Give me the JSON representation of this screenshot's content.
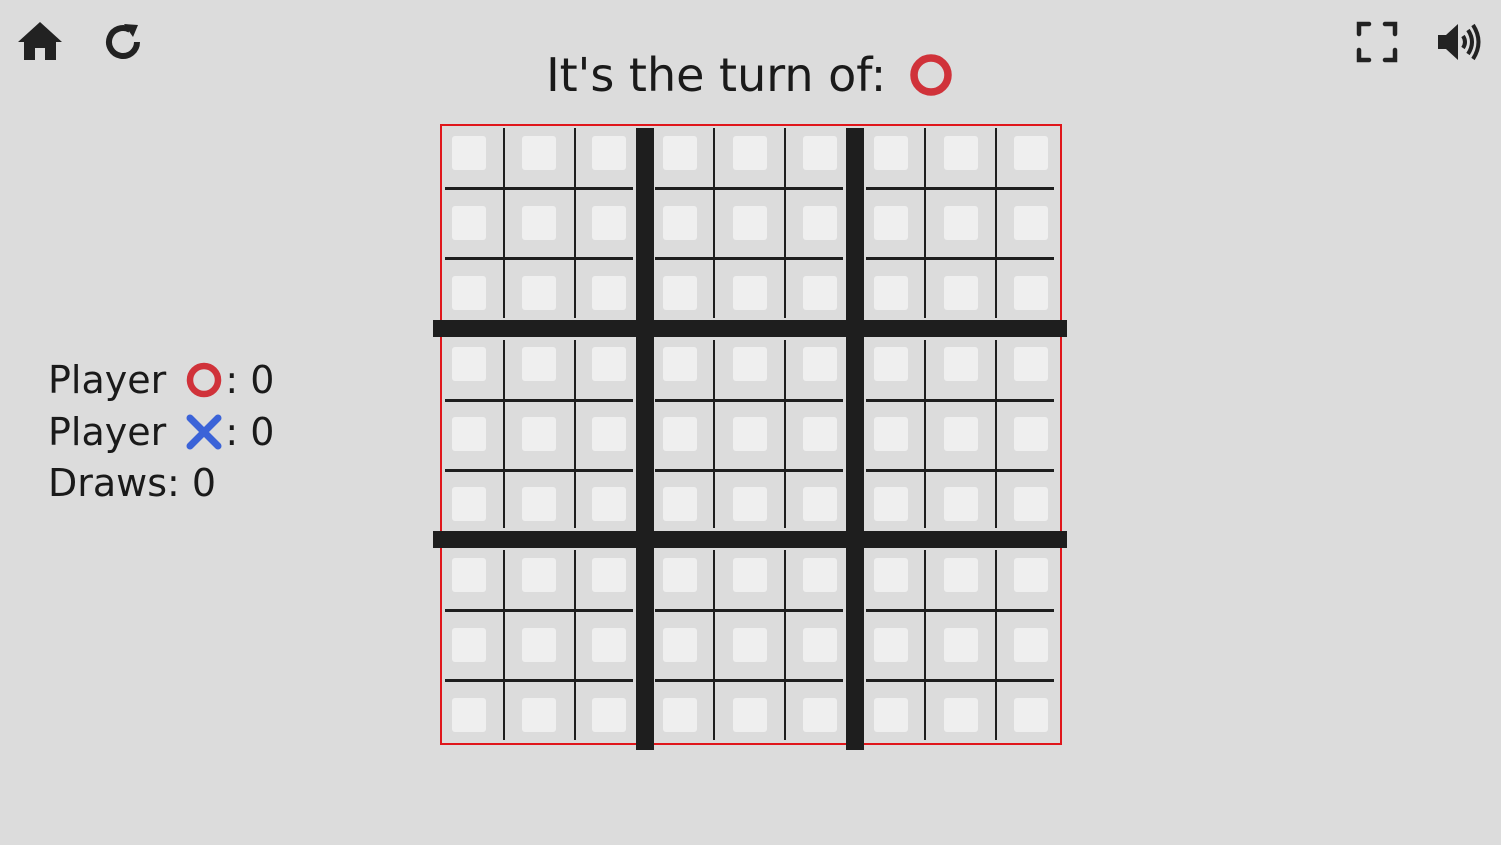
{
  "header": {
    "turn_label": "It's the turn of:",
    "current_player_symbol": "O"
  },
  "toolbar": {
    "home_icon": "home-icon",
    "restart_icon": "restart-icon",
    "fullscreen_icon": "fullscreen-icon",
    "sound_icon": "sound-icon"
  },
  "scores": {
    "o_prefix": "Player ",
    "o_value": ": 0",
    "x_prefix": "Player ",
    "x_value": ": 0",
    "draws": "Draws: 0"
  },
  "board": {
    "big_rows": 3,
    "big_cols": 3,
    "cells_per_side": 3,
    "cells": []
  },
  "colors": {
    "background": "#dcdcdc",
    "o_color": "#d0323a",
    "x_color": "#3b63d8",
    "frame_color": "#e0161b",
    "line_color": "#1e1e1e",
    "cell_color": "#efefef"
  }
}
